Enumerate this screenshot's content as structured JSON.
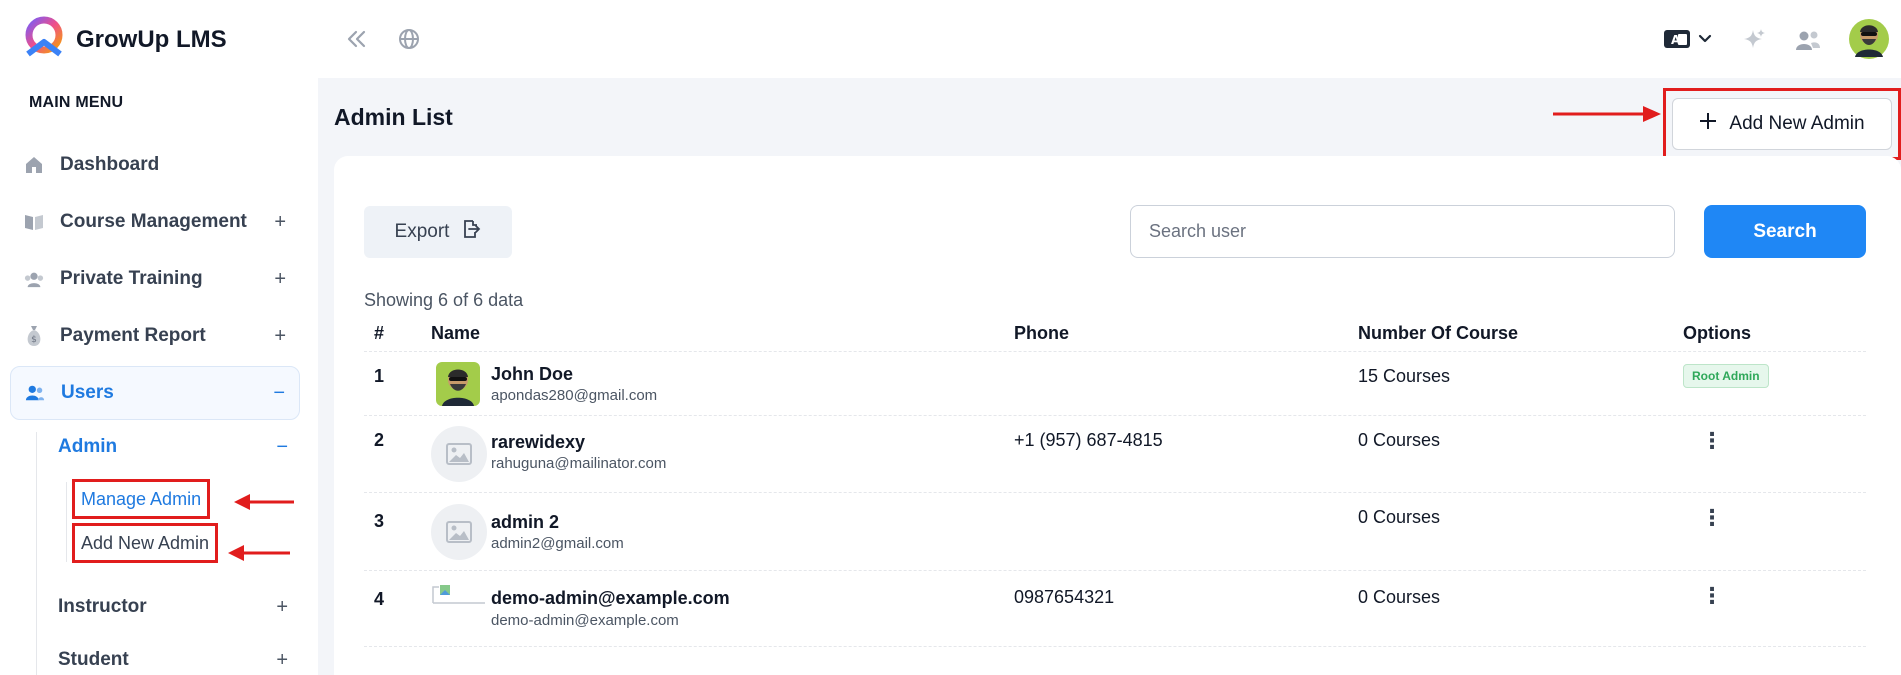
{
  "brand": {
    "name": "GrowUp LMS"
  },
  "sidebar": {
    "heading": "MAIN MENU",
    "items": [
      {
        "label": "Dashboard",
        "icon": "home-icon",
        "toggle": ""
      },
      {
        "label": "Course Management",
        "icon": "book-icon",
        "toggle": "+"
      },
      {
        "label": "Private Training",
        "icon": "training-icon",
        "toggle": "+"
      },
      {
        "label": "Payment Report",
        "icon": "money-bag-icon",
        "toggle": "+"
      },
      {
        "label": "Users",
        "icon": "users-icon",
        "toggle": "−"
      }
    ],
    "users_sub": [
      {
        "label": "Admin",
        "toggle": "−"
      },
      {
        "label": "Instructor",
        "toggle": "+"
      },
      {
        "label": "Student",
        "toggle": "+"
      }
    ],
    "admin_sub": [
      {
        "label": "Manage Admin"
      },
      {
        "label": "Add New Admin"
      }
    ]
  },
  "topbar": {
    "icons": [
      "collapse-icon",
      "globe-icon",
      "language-icon",
      "sparkle-icon",
      "users-switch-icon",
      "avatar"
    ]
  },
  "main": {
    "title": "Admin List",
    "add_button": "Add New Admin",
    "export_label": "Export",
    "search_placeholder": "Search user",
    "search_button": "Search",
    "showing": "Showing 6 of 6 data",
    "columns": [
      "#",
      "Name",
      "Phone",
      "Number Of Course",
      "Options"
    ],
    "rows": [
      {
        "num": "1",
        "name": "John Doe",
        "email": "apondas280@gmail.com",
        "phone": "",
        "courses": "15 Courses",
        "badge": "Root Admin",
        "avatar": "photo"
      },
      {
        "num": "2",
        "name": "rarewidexy",
        "email": "rahuguna@mailinator.com",
        "phone": "+1 (957) 687-4815",
        "courses": "0 Courses",
        "badge": "",
        "avatar": "placeholder"
      },
      {
        "num": "3",
        "name": "admin 2",
        "email": "admin2@gmail.com",
        "phone": "",
        "courses": "0 Courses",
        "badge": "",
        "avatar": "placeholder"
      },
      {
        "num": "4",
        "name": "demo-admin@example.com",
        "email": "demo-admin@example.com",
        "phone": "0987654321",
        "courses": "0 Courses",
        "badge": "",
        "avatar": "broken"
      }
    ]
  },
  "colors": {
    "accent": "#1f87f5",
    "highlight": "#e11d1d",
    "badge": "#2fa85a"
  }
}
